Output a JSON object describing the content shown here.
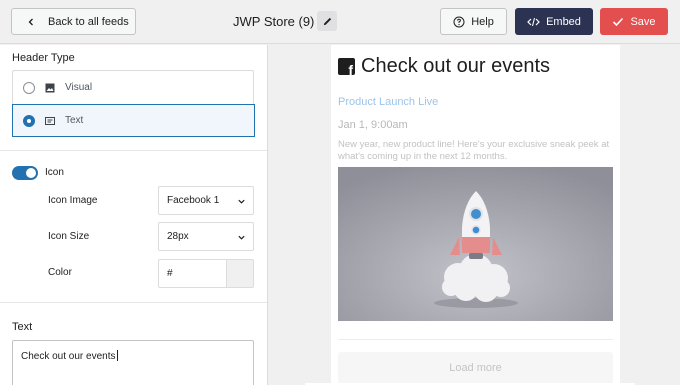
{
  "topbar": {
    "back_label": "Back to all feeds",
    "store_title": "JWP Store (9)",
    "help_label": "Help",
    "embed_label": "Embed",
    "save_label": "Save"
  },
  "colors": {
    "accent": "#2271b1",
    "embed_bg": "#2c3352",
    "save_bg": "#e34f4f",
    "event_link": "#9ec4e8"
  },
  "panel": {
    "header_type_label": "Header Type",
    "header_type_options": [
      {
        "label": "Visual",
        "icon": "image-icon",
        "selected": false
      },
      {
        "label": "Text",
        "icon": "text-icon",
        "selected": true
      }
    ],
    "icon_toggle_label": "Icon",
    "icon_toggle_on": true,
    "icon_image_label": "Icon Image",
    "icon_image_value": "Facebook 1",
    "icon_size_label": "Icon Size",
    "icon_size_value": "28px",
    "color_label": "Color",
    "color_value": "#",
    "text_label": "Text",
    "text_value": "Check out our events"
  },
  "preview": {
    "header_icon": "facebook-square-icon",
    "title": "Check out our events",
    "event_title": "Product Launch Live",
    "event_date": "Jan 1, 9:00am",
    "event_description": "New year, new product line! Here's your exclusive sneak peek at what's coming up in the next 12 months.",
    "image_subject": "rocket-illustration",
    "load_more_label": "Load more"
  }
}
